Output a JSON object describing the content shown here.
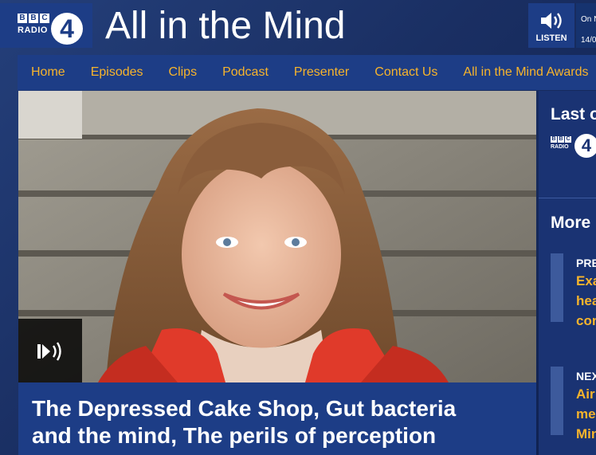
{
  "header": {
    "bbc_letters": [
      "B",
      "B",
      "C"
    ],
    "radio_label": "RADIO",
    "station_number": "4",
    "show_title": "All in the Mind",
    "listen_label": "LISTEN",
    "listen_icon": "speaker-icon",
    "on_now_label": "On N",
    "on_now_date": "14/0"
  },
  "nav": {
    "items": [
      "Home",
      "Episodes",
      "Clips",
      "Podcast",
      "Presenter",
      "Contact Us",
      "All in the Mind Awards"
    ]
  },
  "hero": {
    "audio_icon": "audio-play-icon"
  },
  "episode": {
    "title_line1": "The Depressed Cake Shop, Gut bacteria",
    "title_line2": "and the mind, The perils of perception"
  },
  "sidebar": {
    "last_heading": "Last o",
    "mini_bbc": [
      "B",
      "B",
      "C"
    ],
    "mini_radio": "RADIO",
    "mini_four": "4",
    "more_heading": "More",
    "cards": [
      {
        "kicker": "PRE",
        "lines": [
          "Exa",
          "hea",
          "cor"
        ]
      },
      {
        "kicker": "NEX",
        "lines": [
          "Air",
          "me",
          "Min"
        ]
      }
    ]
  },
  "colors": {
    "brand_blue": "#1d3d86",
    "accent_gold": "#f7b42c"
  }
}
